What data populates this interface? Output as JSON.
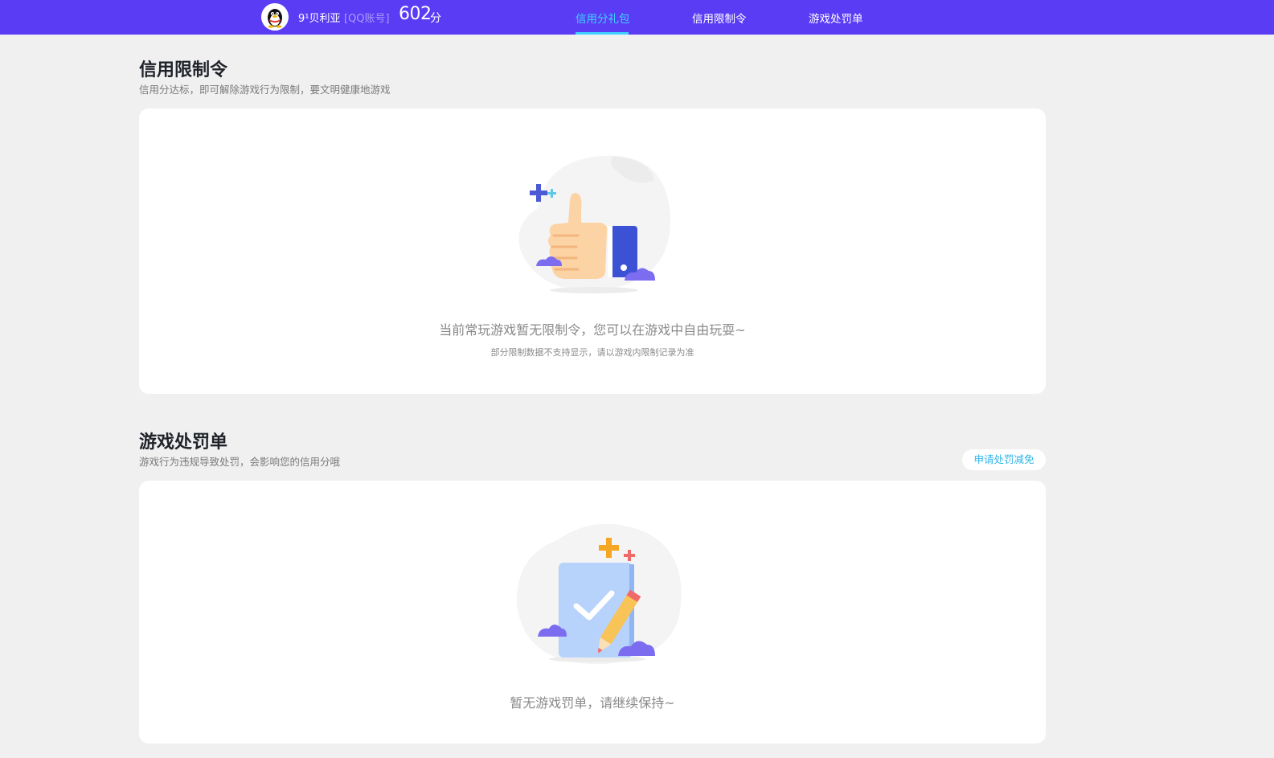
{
  "header": {
    "username": "9¹贝利亚",
    "account_type": "[QQ账号]",
    "score": "602",
    "score_unit": "分",
    "avatar_icon": "qq-penguin-icon"
  },
  "nav": {
    "tabs": [
      {
        "label": "信用分礼包",
        "active": true
      },
      {
        "label": "信用限制令",
        "active": false
      },
      {
        "label": "游戏处罚单",
        "active": false
      }
    ],
    "active_color": "#3fd2ff"
  },
  "restriction": {
    "title": "信用限制令",
    "subtitle": "信用分达标，即可解除游戏行为限制，要文明健康地游戏",
    "empty_message": "当前常玩游戏暂无限制令，您可以在游戏中自由玩耍~",
    "empty_note": "部分限制数据不支持显示，请以游戏内限制记录为准",
    "illustration_icon": "thumbs-up-icon"
  },
  "penalty": {
    "title": "游戏处罚单",
    "subtitle": "游戏行为违规导致处罚，会影响您的信用分哦",
    "apply_button": "申请处罚减免",
    "empty_message": "暂无游戏罚单，请继续保持~",
    "illustration_icon": "document-pencil-icon"
  },
  "colors": {
    "header_bg": "#5a3cf5",
    "page_bg": "#f0f0f0",
    "link": "#2fb6e8"
  }
}
